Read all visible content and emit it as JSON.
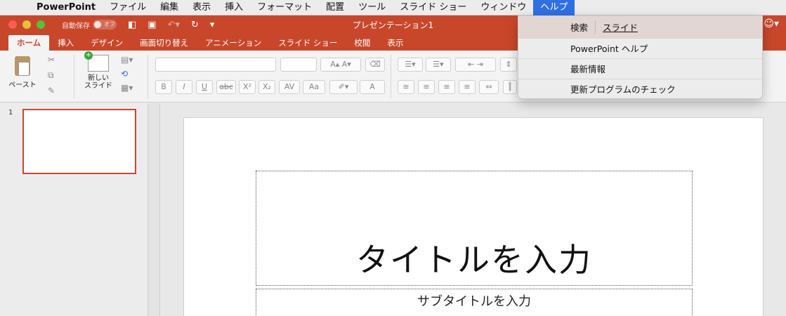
{
  "menubar": {
    "apple": "",
    "app": "PowerPoint",
    "items": [
      "ファイル",
      "編集",
      "表示",
      "挿入",
      "フォーマット",
      "配置",
      "ツール",
      "スライド ショー",
      "ウィンドウ"
    ],
    "active": "ヘルプ"
  },
  "titlebar": {
    "autosave_label": "自動保存",
    "autosave_state": "オフ",
    "doc_title": "プレゼンテーション1"
  },
  "tabs": [
    "ホーム",
    "挿入",
    "デザイン",
    "画面切り替え",
    "アニメーション",
    "スライド ショー",
    "校閲",
    "表示"
  ],
  "ribbon": {
    "paste_label": "ペースト",
    "newslide_line1": "新しい",
    "newslide_line2": "スライド",
    "format_buttons": [
      "B",
      "I",
      "U",
      "abc",
      "X²",
      "X₂",
      "AV",
      "Aa",
      "A"
    ]
  },
  "slides_panel": {
    "number": "1"
  },
  "slide": {
    "title_placeholder": "タイトルを入力",
    "subtitle_placeholder": "サブタイトルを入力"
  },
  "help_menu": {
    "search_label": "検索",
    "search_value": "スライド",
    "items": [
      "PowerPoint ヘルプ",
      "最新情報",
      "更新プログラムのチェック"
    ]
  },
  "colors": {
    "accent": "#c8472b",
    "menu_highlight": "#2f6fe4"
  }
}
